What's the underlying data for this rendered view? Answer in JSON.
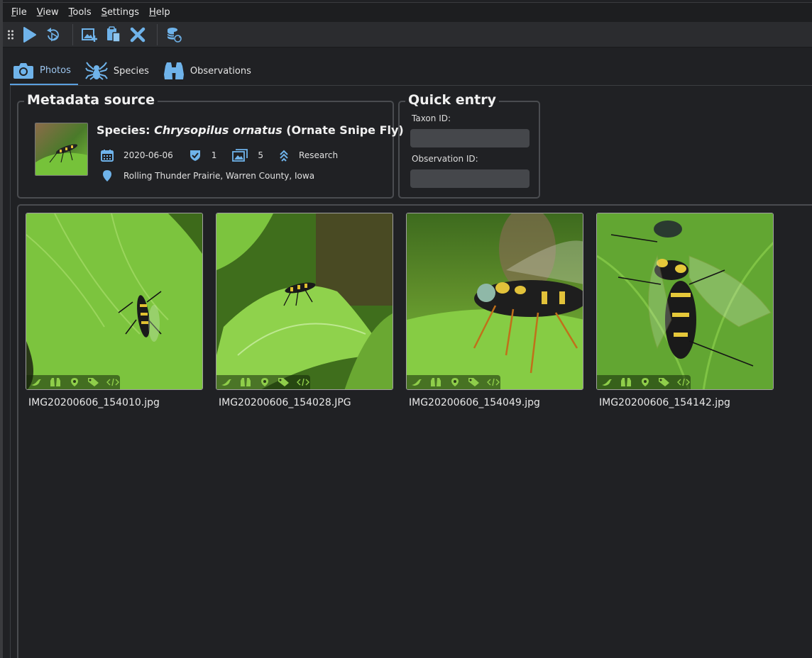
{
  "menu": [
    {
      "u": "F",
      "rest": "ile"
    },
    {
      "u": "V",
      "rest": "iew"
    },
    {
      "u": "T",
      "rest": "ools"
    },
    {
      "u": "S",
      "rest": "ettings"
    },
    {
      "u": "H",
      "rest": "elp"
    }
  ],
  "toolbar_icons": [
    "play-icon",
    "replay-icon",
    "add-image-icon",
    "paste-icon",
    "clear-icon",
    "database-refresh-icon"
  ],
  "tabs": [
    {
      "label": "Photos",
      "icon": "camera-icon",
      "active": true
    },
    {
      "label": "Species",
      "icon": "spider-icon",
      "active": false
    },
    {
      "label": "Observations",
      "icon": "binoculars-icon",
      "active": false
    }
  ],
  "metadata": {
    "title": "Metadata source",
    "species_prefix": "Species: ",
    "species_name": "Chrysopilus ornatus",
    "common_name": "(Ornate Snipe Fly)",
    "date": "2020-06-06",
    "identifications": "1",
    "photos": "5",
    "quality": "Research",
    "location": "Rolling Thunder Prairie, Warren County, Iowa"
  },
  "quick_entry": {
    "title": "Quick entry",
    "taxon_label": "Taxon ID:",
    "taxon_value": "",
    "observation_label": "Observation ID:",
    "observation_value": ""
  },
  "photos": [
    {
      "filename": "IMG20200606_154010.jpg"
    },
    {
      "filename": "IMG20200606_154028.JPG"
    },
    {
      "filename": "IMG20200606_154049.jpg"
    },
    {
      "filename": "IMG20200606_154142.jpg"
    }
  ],
  "colors": {
    "accent": "#5aa0e0",
    "icon_blue": "#6fb3ea",
    "leaf_green": "#7ac43a",
    "strip_icon": "#8fce4a"
  }
}
